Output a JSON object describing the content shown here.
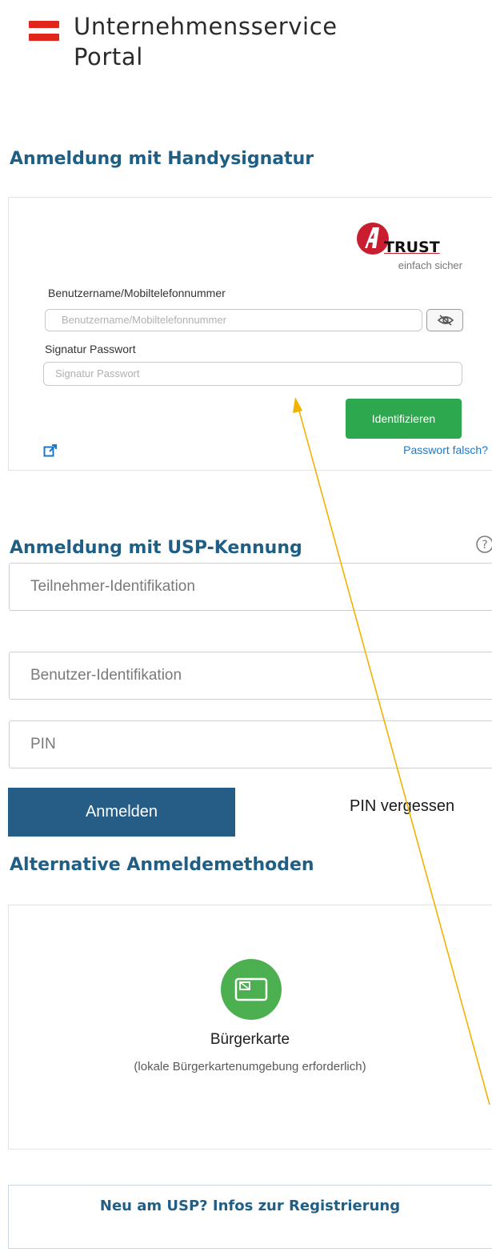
{
  "header": {
    "brand_line1": "Unternehmensservice",
    "brand_line2": "Portal",
    "flag_color": "#e1251b",
    "logo_icon": "austria-flag-icon"
  },
  "handysignatur": {
    "title": "Anmeldung mit Handysignatur",
    "logo": {
      "brand": "TRUST",
      "tagline": "einfach sicher"
    },
    "username_label": "Benutzername/Mobiltelefonnummer",
    "username_placeholder": "Benutzername/Mobiltelefonnummer",
    "password_label": "Signatur Passwort",
    "password_placeholder": "Signatur Passwort",
    "identify_button": "Identifizieren",
    "password_wrong_link": "Passwort falsch?",
    "identify_color": "#2ea84f"
  },
  "usp": {
    "title": "Anmeldung mit USP-Kennung",
    "participant_placeholder": "Teilnehmer-Identifikation",
    "user_placeholder": "Benutzer-Identifikation",
    "pin_placeholder": "PIN",
    "login_button": "Anmelden",
    "pin_forgot_link": "PIN vergessen",
    "login_color": "#255d86"
  },
  "alternative": {
    "title": "Alternative Anmeldemethoden",
    "method_label": "Bürgerkarte",
    "method_note": "(lokale Bürgerkartenumgebung erforderlich)",
    "method_icon": "card-icon"
  },
  "registration": {
    "text": "Neu am USP? Infos zur Registrierung"
  },
  "accent_color": "#1f5f86"
}
